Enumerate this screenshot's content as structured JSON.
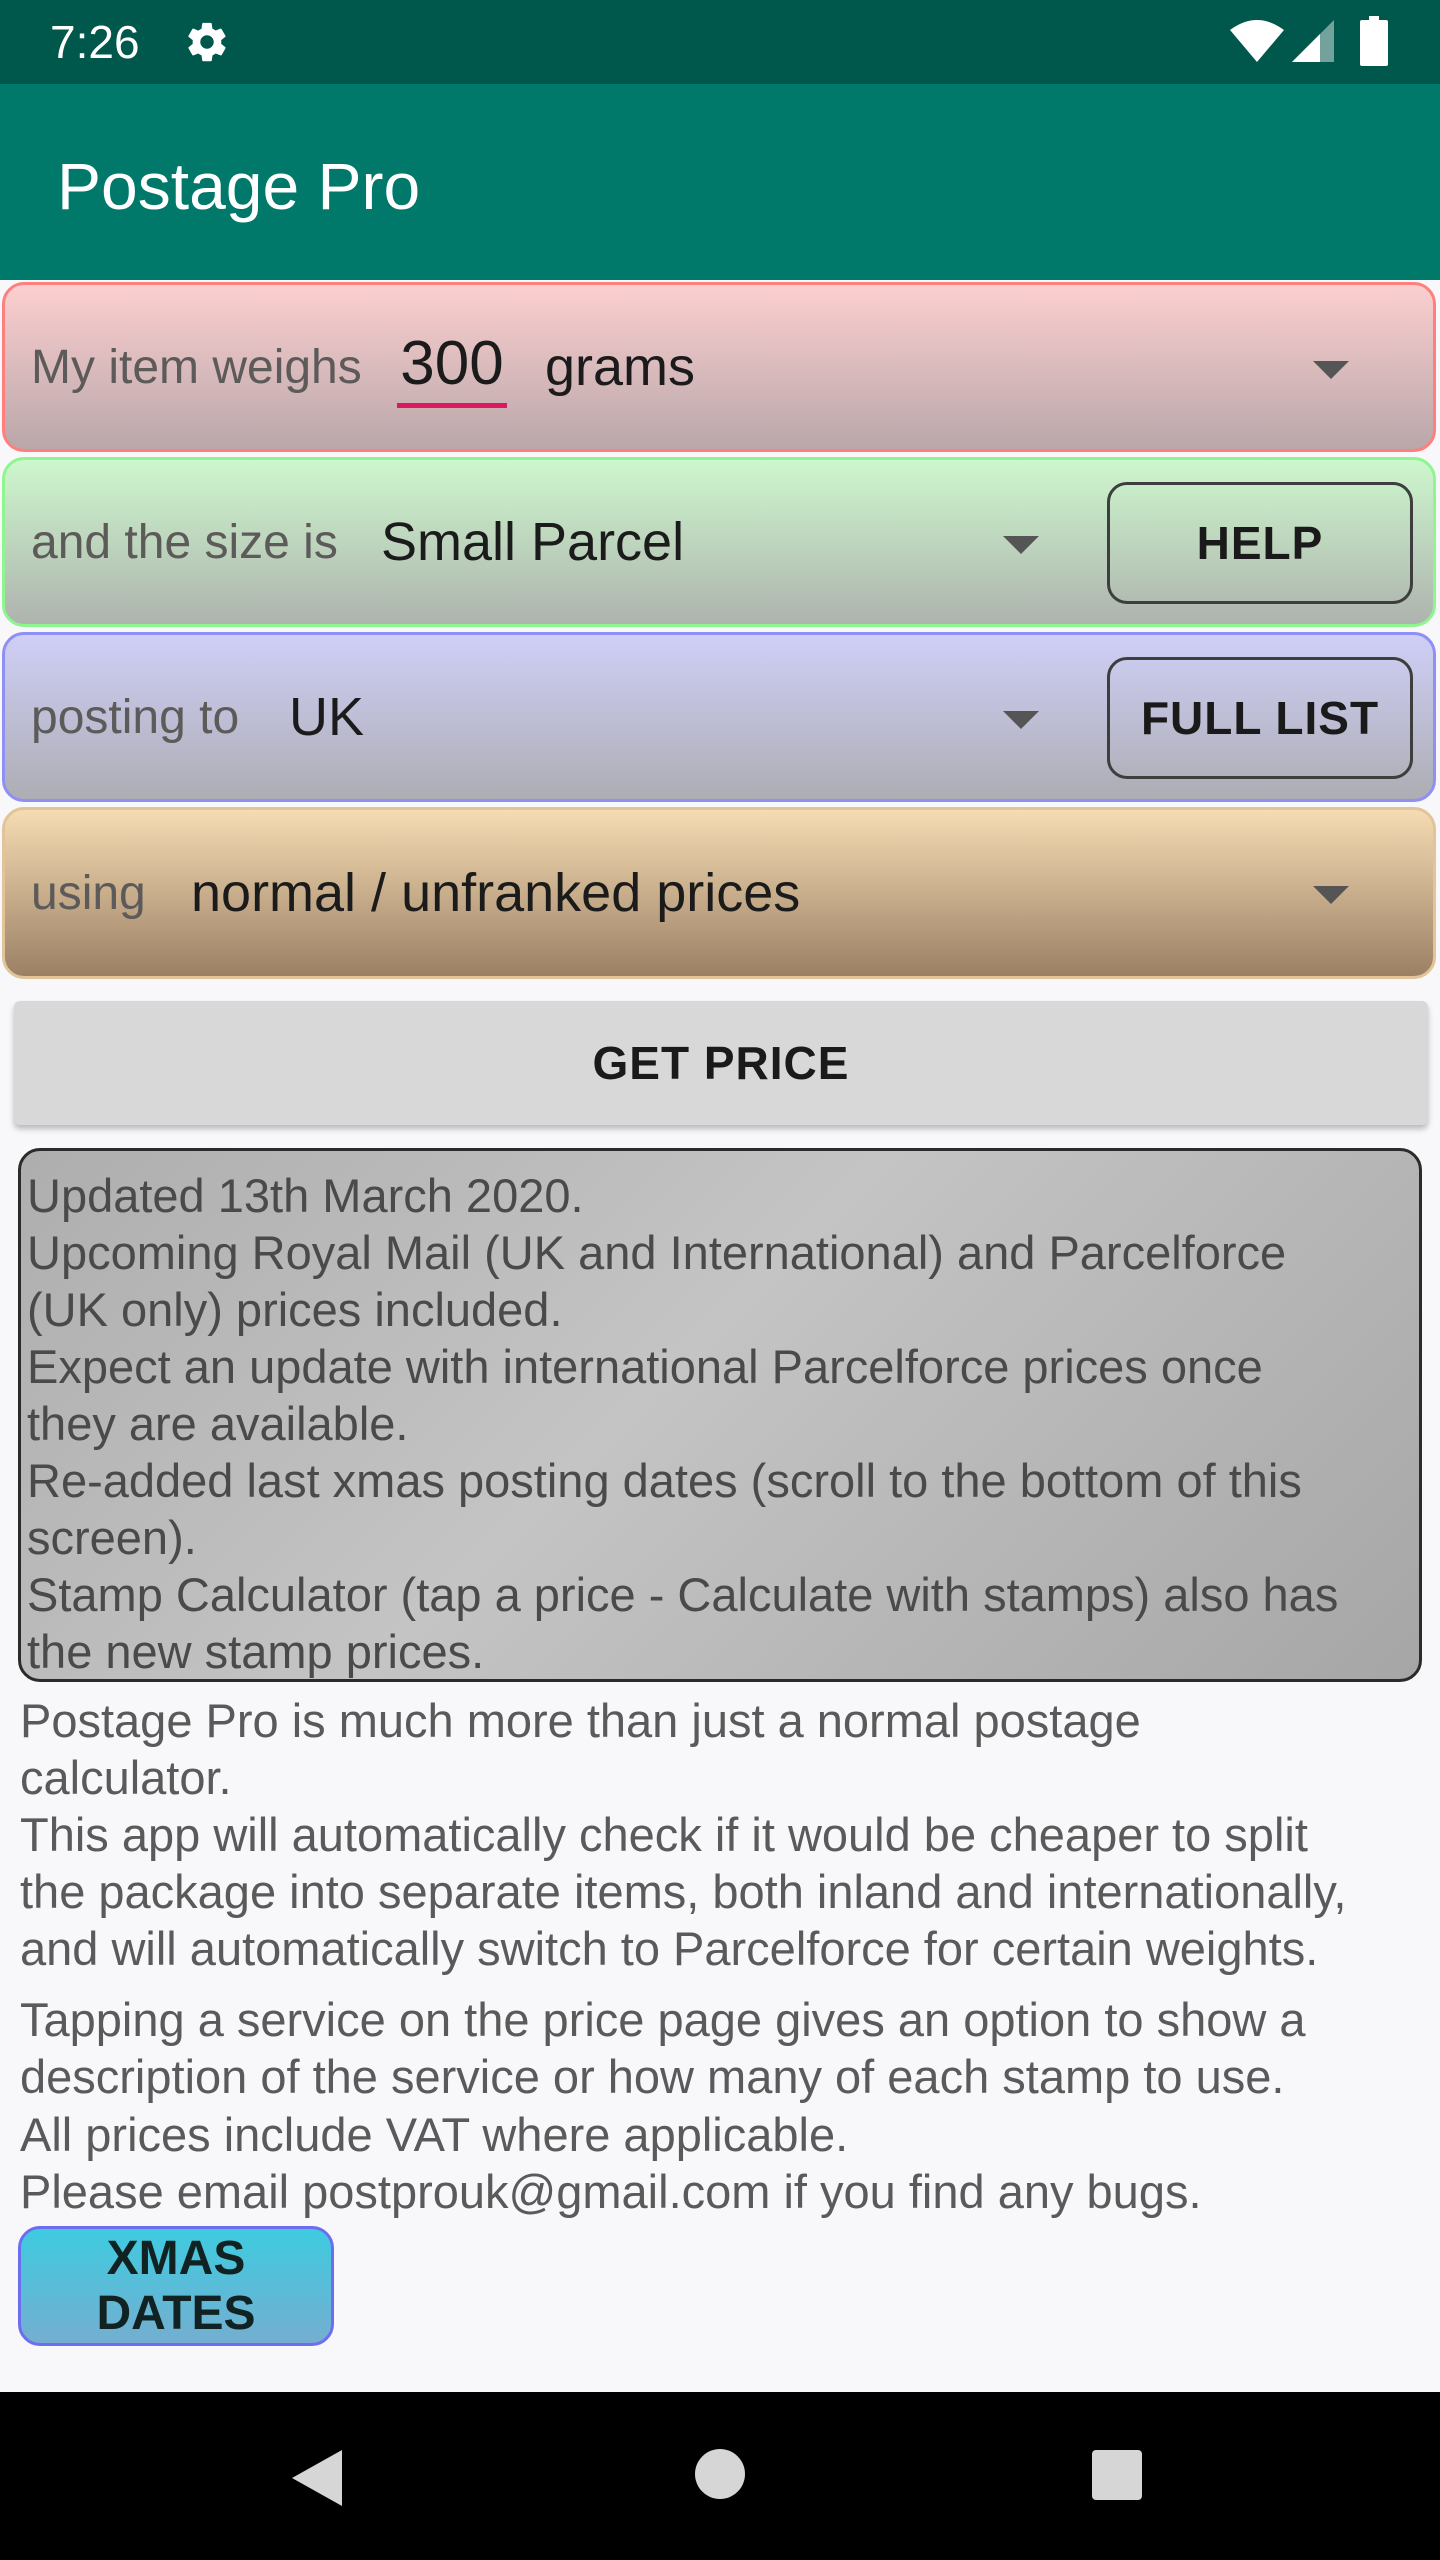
{
  "status_bar": {
    "time": "7:26",
    "icons": [
      "gear-icon",
      "wifi-icon",
      "signal-icon",
      "battery-icon"
    ]
  },
  "app_bar": {
    "title": "Postage Pro"
  },
  "weight_row": {
    "label": "My item weighs",
    "value": "300",
    "unit": "grams"
  },
  "size_row": {
    "label": "and the size is",
    "value": "Small Parcel",
    "help_button": "HELP"
  },
  "destination_row": {
    "label": "posting to",
    "value": "UK",
    "full_list_button": "FULL LIST"
  },
  "pricing_row": {
    "label": "using",
    "value": "normal / unfranked prices"
  },
  "get_price_button": "GET PRICE",
  "news": [
    "Updated 13th March 2020.",
    "Upcoming Royal Mail (UK and International) and Parcelforce",
    "(UK only) prices included.",
    "Expect an update with international Parcelforce prices once",
    "they are available.",
    "Re-added last xmas posting dates (scroll to the bottom of this",
    "screen).",
    "Stamp Calculator (tap a price - Calculate with stamps) also has",
    "the new stamp prices."
  ],
  "info": {
    "para1": [
      "Postage Pro is much more than just a normal postage",
      "calculator.",
      "This app will automatically check if it would be cheaper to split",
      "the package into separate items, both inland and internationally,",
      "and will automatically switch to Parcelforce for certain weights."
    ],
    "para2": [
      "Tapping a service on the price page gives an option to show a",
      "description of the service or how many of each stamp to use."
    ],
    "para3": [
      "All prices include VAT where applicable.",
      "Please email postprouk@gmail.com if you find any bugs."
    ]
  },
  "xmas_button": "XMAS DATES",
  "colors": {
    "status_bar": "#00574b",
    "app_bar": "#00796b",
    "accent": "#d81b60",
    "weight_row_border": "#ff7f7f",
    "size_row_border": "#8ff58f",
    "destination_row_border": "#8f8ff5",
    "pricing_row_border": "#e2c49a"
  },
  "nav_bar": {
    "icons": [
      "back-icon",
      "home-icon",
      "recents-icon"
    ]
  }
}
